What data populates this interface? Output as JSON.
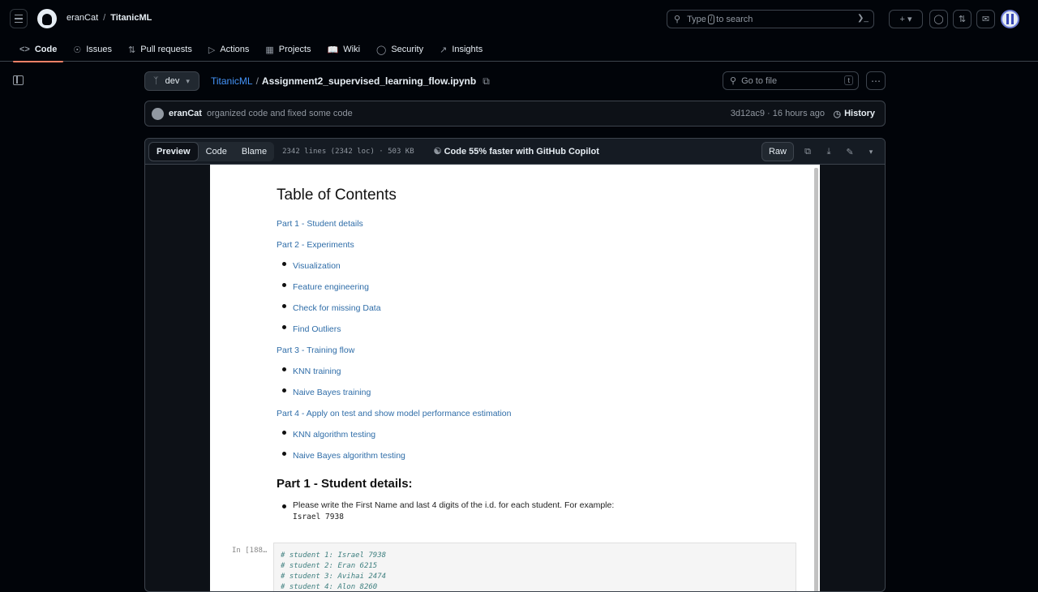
{
  "topbar": {
    "owner": "eranCat",
    "separator": "/",
    "repo": "TitanicML",
    "search_pre": "Type",
    "search_key": "/",
    "search_post": "to search",
    "add_symbol": "+"
  },
  "repo_nav": {
    "tabs": [
      {
        "label": "Code",
        "icon": "code-icon"
      },
      {
        "label": "Issues",
        "icon": "issue-icon"
      },
      {
        "label": "Pull requests",
        "icon": "pull-request-icon"
      },
      {
        "label": "Actions",
        "icon": "play-icon"
      },
      {
        "label": "Projects",
        "icon": "table-icon"
      },
      {
        "label": "Wiki",
        "icon": "book-icon"
      },
      {
        "label": "Security",
        "icon": "shield-icon"
      },
      {
        "label": "Insights",
        "icon": "graph-icon"
      }
    ]
  },
  "file_header": {
    "branch": "dev",
    "repo_link": "TitanicML",
    "separator": "/",
    "filename": "Assignment2_supervised_learning_flow.ipynb",
    "goto_placeholder": "Go to file",
    "goto_key": "t"
  },
  "commit": {
    "author": "eranCat",
    "message": "organized code and fixed some code",
    "meta": "3d12ac9 · 16 hours ago",
    "history_label": "History"
  },
  "file_toolbar": {
    "tabs": [
      "Preview",
      "Code",
      "Blame"
    ],
    "info": "2342 lines (2342 loc) · 503 KB",
    "copilot": "Code 55% faster with GitHub Copilot",
    "raw": "Raw"
  },
  "notebook": {
    "toc_title": "Table of Contents",
    "toc": [
      {
        "level": 0,
        "text": "Part 1 - Student details"
      },
      {
        "level": 0,
        "text": "Part 2 - Experiments"
      },
      {
        "level": 1,
        "text": "Visualization"
      },
      {
        "level": 1,
        "text": "Feature engineering"
      },
      {
        "level": 1,
        "text": "Check for missing Data"
      },
      {
        "level": 1,
        "text": "Find Outliers"
      },
      {
        "level": 0,
        "text": "Part 3 - Training flow"
      },
      {
        "level": 1,
        "text": "KNN training"
      },
      {
        "level": 1,
        "text": "Naive Bayes training"
      },
      {
        "level": 0,
        "text": "Part 4 - Apply on test and show model performance estimation"
      },
      {
        "level": 1,
        "text": "KNN algorithm testing"
      },
      {
        "level": 1,
        "text": "Naive Bayes algorithm testing"
      }
    ],
    "part1_heading": "Part 1 - Student details:",
    "part1_note": "Please write the First Name and last 4 digits of the i.d. for each student. For example:",
    "part1_example": "Israel 7938",
    "cell_prompt": "In [188…",
    "code_lines": [
      "# student 1: Israel 7938",
      "# student 2: Eran 6215",
      "# student 3: Avihai 2474",
      "# student 4: Alon 8260"
    ]
  }
}
